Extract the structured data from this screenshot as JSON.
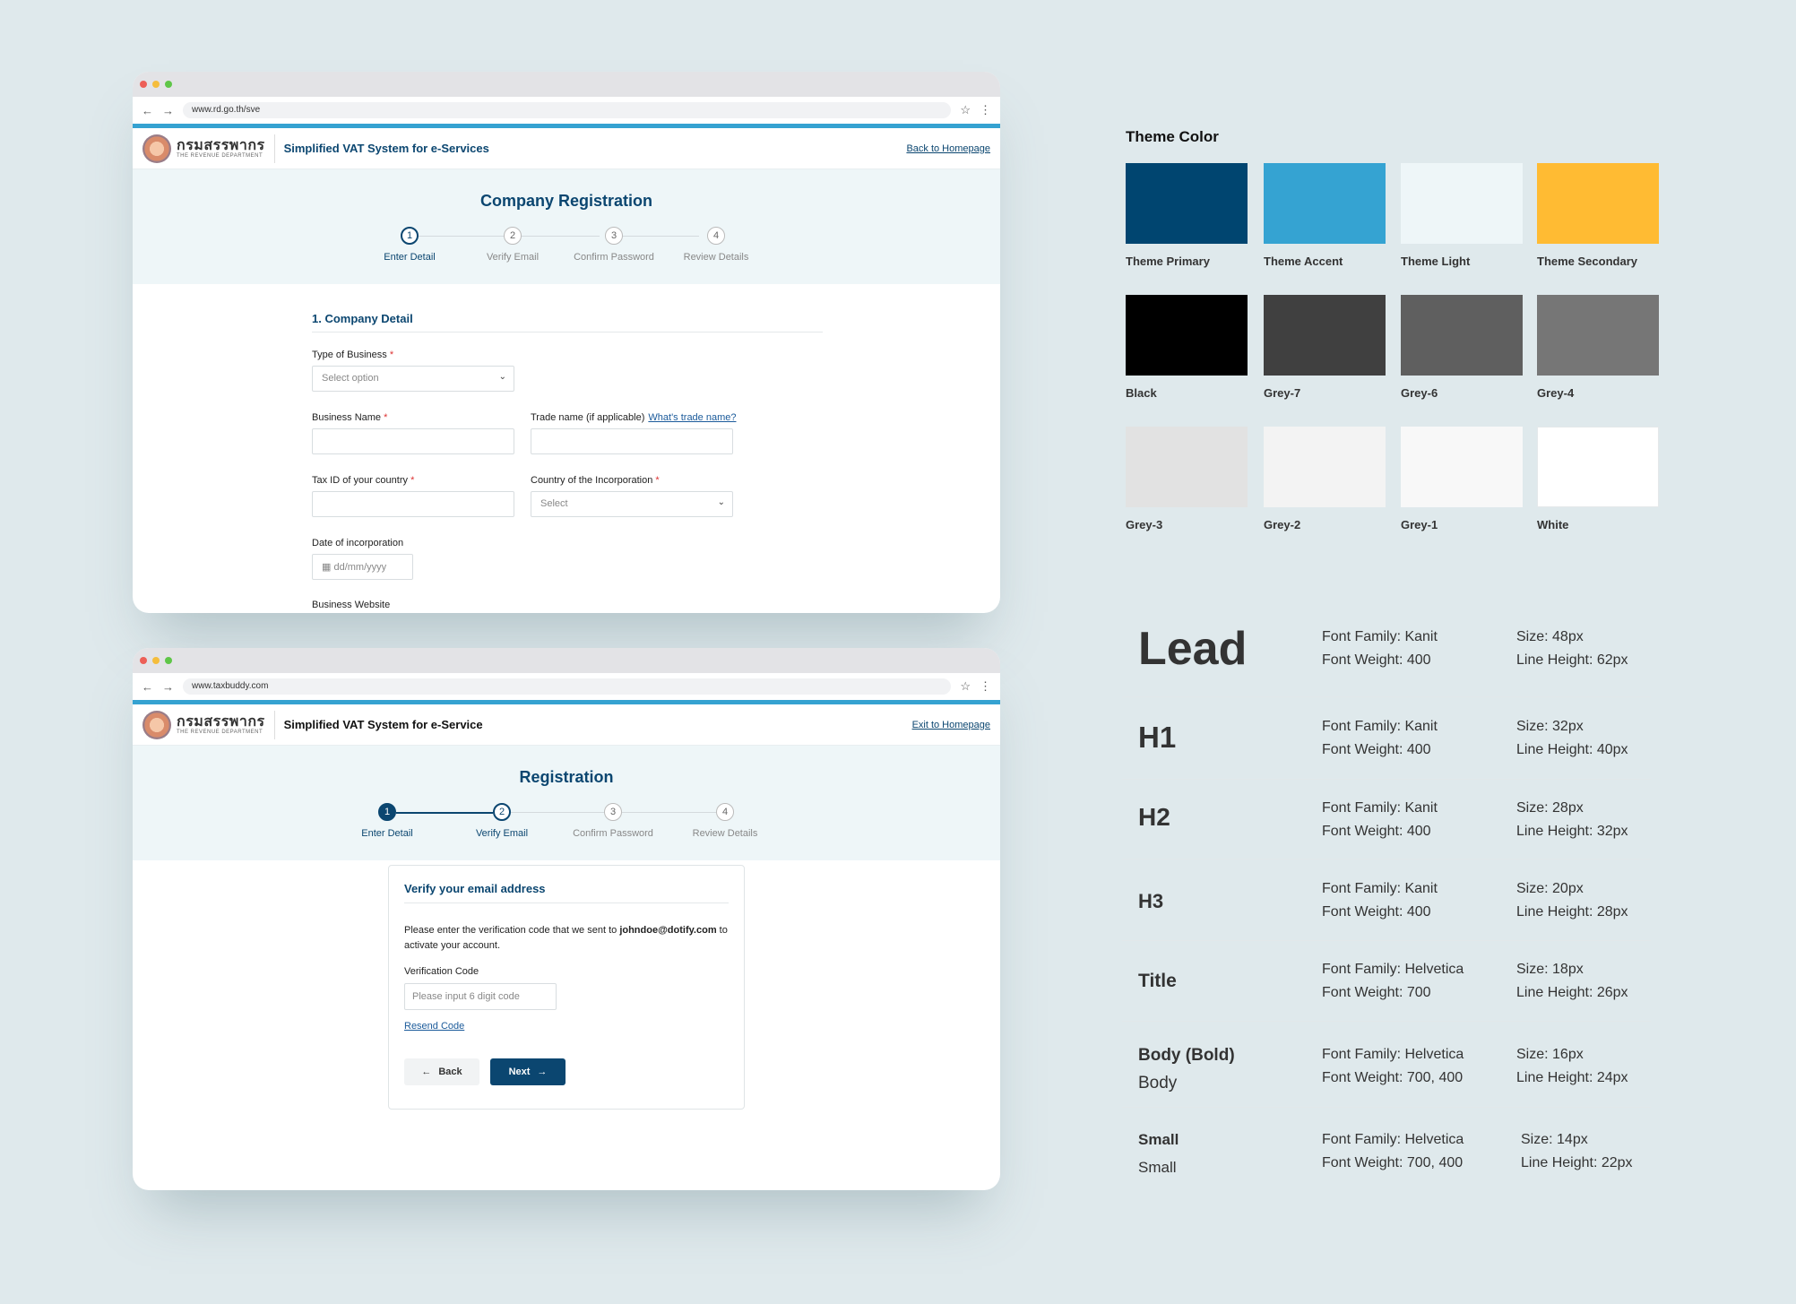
{
  "window1": {
    "url": "www.rd.go.th/sve",
    "logo_th": "กรมสรรพากร",
    "logo_en": "THE REVENUE DEPARTMENT",
    "app_name": "Simplified VAT System for e-Services",
    "home_link": "Back to Homepage",
    "page_title": "Company Registration",
    "steps": [
      {
        "num": "1",
        "label": "Enter Detail"
      },
      {
        "num": "2",
        "label": "Verify Email"
      },
      {
        "num": "3",
        "label": "Confirm Password"
      },
      {
        "num": "4",
        "label": "Review Details"
      }
    ],
    "section_title": "1. Company Detail",
    "fields": {
      "business_type_label": "Type of Business",
      "business_type_value": "Select option",
      "business_name_label": "Business Name",
      "trade_name_label": "Trade name (if applicable)",
      "trade_name_help": "What's trade name?",
      "tax_id_label": "Tax ID of your country",
      "country_label": "Country of the Incorporation",
      "country_value": "Select",
      "date_label": "Date of incorporation",
      "date_placeholder": "dd/mm/yyyy",
      "website_label": "Business Website"
    },
    "required_mark": "*"
  },
  "window2": {
    "url": "www.taxbuddy.com",
    "logo_th": "กรมสรรพากร",
    "logo_en": "THE REVENUE DEPARTMENT",
    "app_name": "Simplified VAT System for e-Service",
    "home_link": "Exit to Homepage",
    "page_title": "Registration",
    "steps": [
      {
        "num": "1",
        "label": "Enter Detail"
      },
      {
        "num": "2",
        "label": "Verify Email"
      },
      {
        "num": "3",
        "label": "Confirm Password"
      },
      {
        "num": "4",
        "label": "Review Details"
      }
    ],
    "card": {
      "title": "Verify your email address",
      "message_start": "Please enter the verification code that we sent to ",
      "email": "johndoe@dotify.com",
      "message_end": " to activate your account.",
      "code_label": "Verification Code",
      "code_placeholder": "Please input 6 digit code",
      "resend": "Resend Code",
      "back": "Back",
      "next": "Next"
    }
  },
  "theme": {
    "title": "Theme Color",
    "swatches": [
      {
        "name": "Theme Primary",
        "color": "#004570"
      },
      {
        "name": "Theme Accent",
        "color": "#35a3d2"
      },
      {
        "name": "Theme Light",
        "color": "#eef6f8"
      },
      {
        "name": "Theme Secondary",
        "color": "#ffbb33"
      },
      {
        "name": "Black",
        "color": "#000000"
      },
      {
        "name": "Grey-7",
        "color": "#404040"
      },
      {
        "name": "Grey-6",
        "color": "#5f5f5f"
      },
      {
        "name": "Grey-4",
        "color": "#767676"
      },
      {
        "name": "Grey-3",
        "color": "#e2e2e2"
      },
      {
        "name": "Grey-2",
        "color": "#f3f3f3"
      },
      {
        "name": "Grey-1",
        "color": "#f8f8f8"
      },
      {
        "name": "White",
        "color": "#ffffff"
      }
    ]
  },
  "typography": [
    {
      "name": "Lead",
      "family": "Font Family: Kanit",
      "weight": "Font Weight: 400",
      "size": "Size: 48px",
      "line": "Line Height: 62px"
    },
    {
      "name": "H1",
      "family": "Font Family: Kanit",
      "weight": "Font Weight: 400",
      "size": "Size: 32px",
      "line": "Line Height: 40px"
    },
    {
      "name": "H2",
      "family": "Font Family: Kanit",
      "weight": "Font Weight: 400",
      "size": "Size: 28px",
      "line": "Line Height: 32px"
    },
    {
      "name": "H3",
      "family": "Font Family: Kanit",
      "weight": "Font Weight: 400",
      "size": "Size: 20px",
      "line": "Line Height: 28px"
    },
    {
      "name": "Title",
      "family": "Font Family: Helvetica",
      "weight": "Font Weight: 700",
      "size": "Size: 18px",
      "line": "Line Height: 26px"
    },
    {
      "name": "Body (Bold)",
      "name2": "Body",
      "family": "Font Family: Helvetica",
      "weight": "Font Weight: 700, 400",
      "size": "Size: 16px",
      "line": "Line Height: 24px"
    },
    {
      "name": "Small",
      "name2": "Small",
      "family": "Font Family: Helvetica",
      "weight": "Font Weight: 700, 400",
      "size": "Size: 14px",
      "line": "Line Height: 22px"
    }
  ]
}
